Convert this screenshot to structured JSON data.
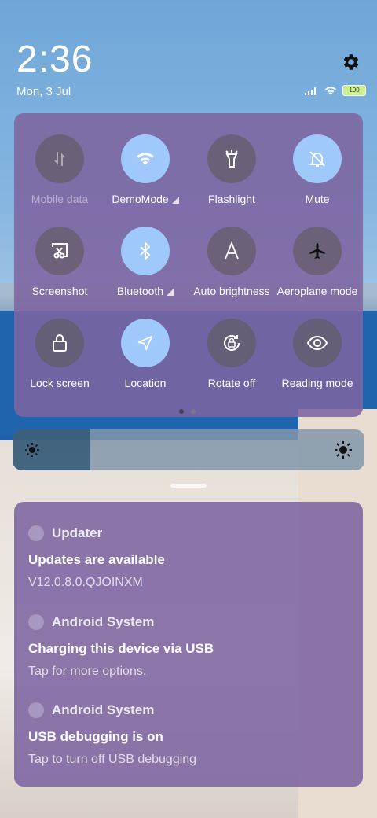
{
  "status_bar": {
    "time": "2:36",
    "date": "Mon, 3 Jul",
    "battery": "100",
    "icons": [
      "signal-icon",
      "wifi-icon",
      "battery-icon"
    ]
  },
  "quick_settings": {
    "tiles": [
      {
        "label": "Mobile data",
        "icon": "mobile-data-icon",
        "state": "disabled"
      },
      {
        "label": "DemoMode",
        "icon": "wifi-icon",
        "state": "on"
      },
      {
        "label": "Flashlight",
        "icon": "flashlight-icon",
        "state": "off"
      },
      {
        "label": "Mute",
        "icon": "bell-off-icon",
        "state": "on"
      },
      {
        "label": "Screenshot",
        "icon": "screenshot-icon",
        "state": "off"
      },
      {
        "label": "Bluetooth",
        "icon": "bluetooth-icon",
        "state": "on"
      },
      {
        "label": "Auto brightness",
        "icon": "auto-brightness-icon",
        "state": "off"
      },
      {
        "label": "Aeroplane mode",
        "icon": "airplane-icon",
        "state": "off"
      },
      {
        "label": "Lock screen",
        "icon": "lock-icon",
        "state": "off"
      },
      {
        "label": "Location",
        "icon": "location-icon",
        "state": "on"
      },
      {
        "label": "Rotate off",
        "icon": "rotate-lock-icon",
        "state": "off"
      },
      {
        "label": "Reading mode",
        "icon": "eye-icon",
        "state": "off"
      }
    ],
    "page": 1,
    "pages": 2
  },
  "brightness": {
    "level": 0.22
  },
  "notifications": [
    {
      "app": "Updater",
      "title": "Updates are available",
      "body": "V12.0.8.0.QJOINXM"
    },
    {
      "app": "Android System",
      "title": "Charging this device via USB",
      "body": "Tap for more options."
    },
    {
      "app": "Android System",
      "title": "USB debugging is on",
      "body": "Tap to turn off USB debugging"
    }
  ],
  "colors": {
    "panel": "#7d64a0",
    "tile_on": "#9fc9fb",
    "tile_off": "#5f5a5f"
  }
}
